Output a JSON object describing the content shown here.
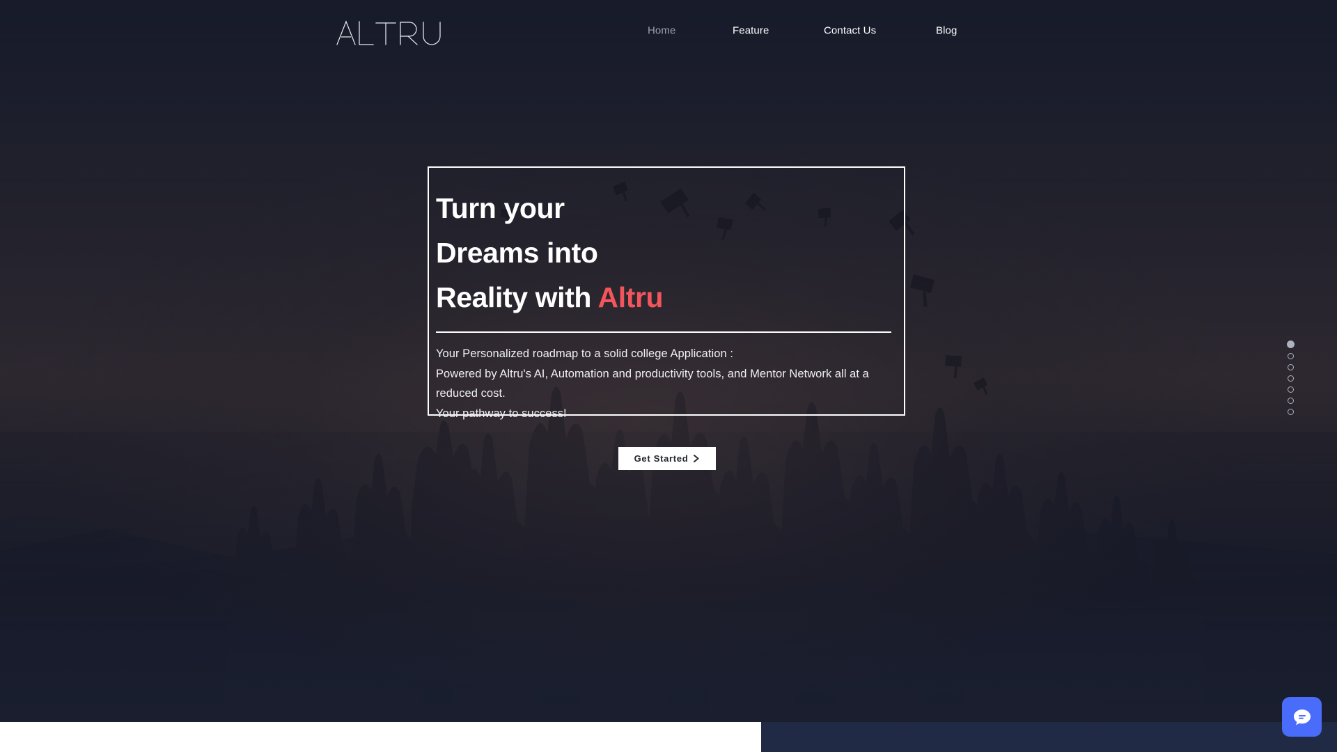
{
  "site": {
    "brand_name": "ALTRU",
    "accent_color": "#f2555c",
    "background_color": "#1b2030",
    "chat_color": "#4a6cfa"
  },
  "header": {
    "logo_text": "ALTRU",
    "logo_icon": "altru-wordmark-logo",
    "nav": [
      {
        "label": "Home",
        "name": "home",
        "state": "dim"
      },
      {
        "label": "Feature",
        "name": "feature",
        "state": "normal"
      },
      {
        "label": "Contact Us",
        "name": "contact-us",
        "state": "normal"
      },
      {
        "label": "Blog",
        "name": "blog",
        "state": "normal"
      }
    ]
  },
  "hero": {
    "headline_line1": "Turn your",
    "headline_line2": "Dreams into",
    "headline_line3_prefix": "Reality with ",
    "headline_line3_brand": "Altru",
    "subcopy": "Your Personalized roadmap to a solid college Application :\nPowered by Altru's AI, Automation and productivity tools, and Mentor Network all at a reduced cost.\nYour pathway to success!",
    "cta_label": "Get Started",
    "cta_icon": "chevron-right-icon",
    "background_image": "graduation-ceremony-silhouette-photo"
  },
  "section_nav": {
    "total": 7,
    "active_index": 0,
    "dots": [
      {
        "label": "Section 1",
        "active": true
      },
      {
        "label": "Section 2",
        "active": false
      },
      {
        "label": "Section 3",
        "active": false
      },
      {
        "label": "Section 4",
        "active": false
      },
      {
        "label": "Section 5",
        "active": false
      },
      {
        "label": "Section 6",
        "active": false
      },
      {
        "label": "Section 7",
        "active": false
      }
    ]
  },
  "chat": {
    "icon": "chat-bubble-icon",
    "label": "Wix Chat"
  }
}
